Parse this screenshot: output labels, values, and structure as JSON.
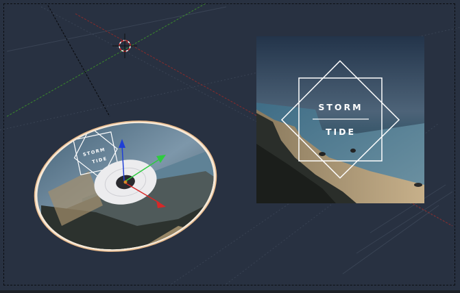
{
  "viewport": {
    "background": "#283141",
    "x_axis_color": "#8a2b2b",
    "y_axis_color": "#3b8a2b"
  },
  "album_cover": {
    "line1": "STORM",
    "line2": "TIDE"
  },
  "disc_label": {
    "line1": "STORM",
    "line2": "TIDE"
  },
  "gizmo": {
    "x_axis_color": "#d62828",
    "y_axis_color": "#2ecc40",
    "z_axis_color": "#1f3fd6"
  },
  "icons": {
    "cursor": "3d-cursor-icon"
  }
}
